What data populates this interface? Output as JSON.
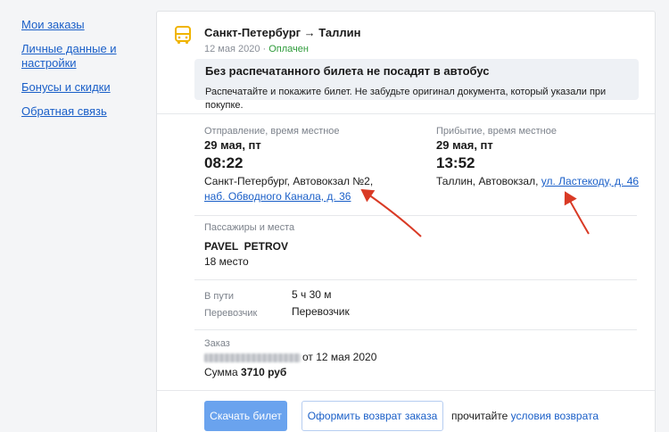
{
  "sidebar": {
    "items": [
      {
        "label": "Мои заказы"
      },
      {
        "label": "Личные данные и настройки"
      },
      {
        "label": "Бонусы и скидки"
      },
      {
        "label": "Обратная связь"
      }
    ]
  },
  "order": {
    "route": "Санкт-Петербург → Таллин",
    "date": "12 мая 2020",
    "separator": " · ",
    "status": "Оплачен"
  },
  "notice": {
    "title": "Без распечатанного билета не посадят в автобус",
    "text": "Распечатайте и покажите билет. Не забудьте оригинал документа, который указали при покупке."
  },
  "departure": {
    "label": "Отправление, время местное",
    "date": "29 мая, пт",
    "time": "08:22",
    "station": "Санкт-Петербург, Автовокзал №2, ",
    "address": "наб. Обводного Канала, д. 36"
  },
  "arrival": {
    "label": "Прибытие, время местное",
    "date": "29 мая, пт",
    "time": "13:52",
    "station": "Таллин, Автовокзал, ",
    "address": "ул. Ластекоду, д. 46"
  },
  "passengers": {
    "label": "Пассажиры и места",
    "name": "PAVEL  PETROV",
    "seat": "18 место"
  },
  "trip": {
    "duration_label": "В пути",
    "duration": "5 ч 30 м",
    "carrier_label": "Перевозчик",
    "carrier": "Перевозчик"
  },
  "order_info": {
    "label": "Заказ",
    "date_suffix": "от 12 мая 2020",
    "sum_label": "Сумма ",
    "sum": "3710 руб"
  },
  "actions": {
    "download": "Скачать билет",
    "refund": "Оформить возврат заказа",
    "read_prefix": "прочитайте ",
    "read_link": "условия возврата"
  },
  "colors": {
    "link": "#1a5fc8",
    "status": "#2e9b3a",
    "primary_button": "#6aa3ee",
    "arrow": "#d93a25",
    "bus_icon": "#f0b400"
  }
}
